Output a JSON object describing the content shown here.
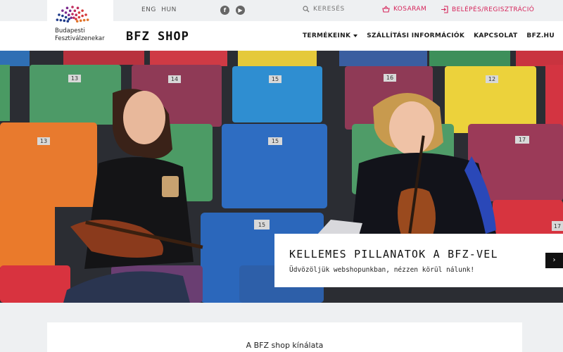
{
  "topbar": {
    "lang_en": "ENG",
    "lang_hu": "HUN",
    "facebook_icon": "facebook-icon",
    "youtube_icon": "youtube-icon",
    "search_label": "KERESÉS",
    "cart_label": "KOSARAM",
    "login_label": "BELÉPÉS/REGISZTRÁCIÓ"
  },
  "header": {
    "logo_line1": "Budapesti",
    "logo_line2": "Fesztiválzenekar",
    "shop_title": "BFZ SHOP",
    "nav": {
      "products": "TERMÉKEINK",
      "shipping": "SZÁLLÍTÁSI INFORMÁCIÓK",
      "contact": "KAPCSOLAT",
      "site": "BFZ.HU"
    }
  },
  "hero": {
    "seat_numbers": [
      "13",
      "14",
      "15",
      "16",
      "12",
      "13",
      "15",
      "17",
      "15",
      "17"
    ],
    "caption_title": "KELLEMES PILLANATOK A BFZ-VEL",
    "caption_subtitle": "Üdvözöljük webshopunkban, nézzen körül nálunk!",
    "next_label": "›"
  },
  "offer": {
    "title": "A BFZ shop kínálata"
  },
  "colors": {
    "accent": "#d6245a",
    "topbar_bg": "#eef0f2",
    "header_bg": "#ffffff",
    "button_dark": "#111111"
  }
}
